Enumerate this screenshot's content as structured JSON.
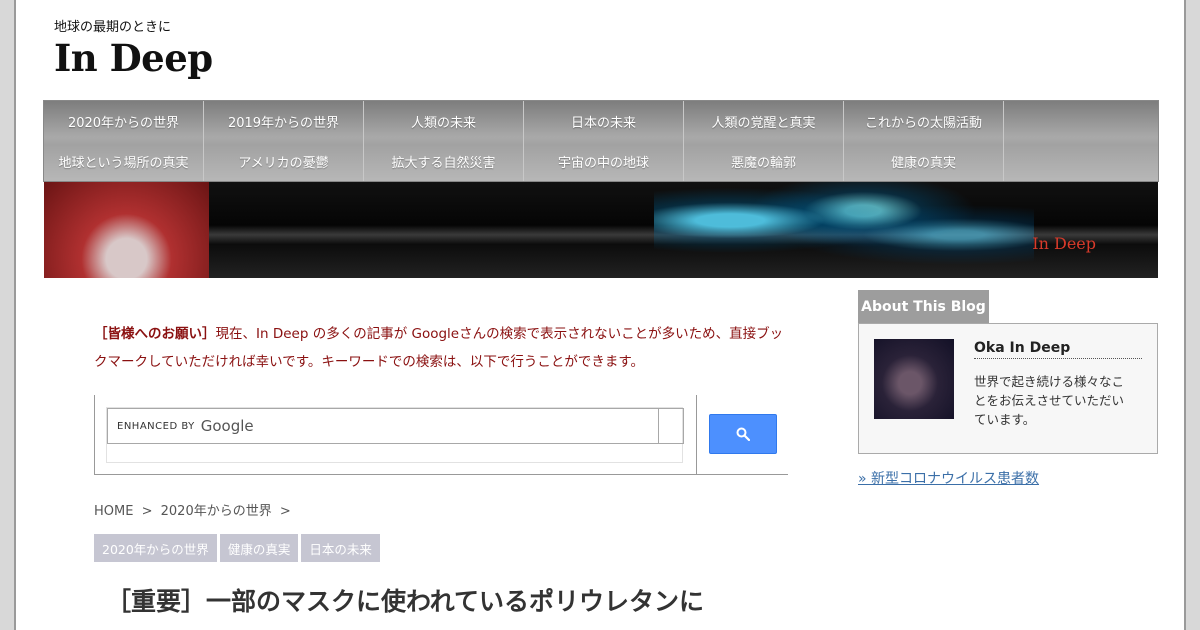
{
  "header": {
    "tagline": "地球の最期のときに",
    "logo": "In Deep"
  },
  "nav": {
    "row1": [
      "2020年からの世界",
      "2019年からの世界",
      "人類の未来",
      "日本の未来",
      "人類の覚醒と真実",
      "これからの太陽活動"
    ],
    "row2": [
      "地球という場所の真実",
      "アメリカの憂鬱",
      "拡大する自然災害",
      "宇宙の中の地球",
      "悪魔の輪郭",
      "健康の真実"
    ]
  },
  "banner": {
    "brand": "In Deep"
  },
  "notice": {
    "lead": "［皆様へのお願い］",
    "body": "現在、In Deep の多くの記事が Googleさんの検索で表示されないことが多いため、直接ブックマークしていただければ幸いです。キーワードでの検索は、以下で行うことができます。"
  },
  "search": {
    "enhanced_by": "ENHANCED BY",
    "brand": "Google"
  },
  "breadcrumb": {
    "home": "HOME",
    "sep": ">",
    "category": "2020年からの世界"
  },
  "tags": [
    "2020年からの世界",
    "健康の真実",
    "日本の未来"
  ],
  "article": {
    "title": "［重要］一部のマスクに使われているポリウレタンに"
  },
  "sidebar": {
    "about_title": "About This Blog",
    "author": "Oka In Deep",
    "description": "世界で起き続ける様々なことをお伝えさせていただいています。",
    "link": "» 新型コロナウイルス患者数"
  }
}
